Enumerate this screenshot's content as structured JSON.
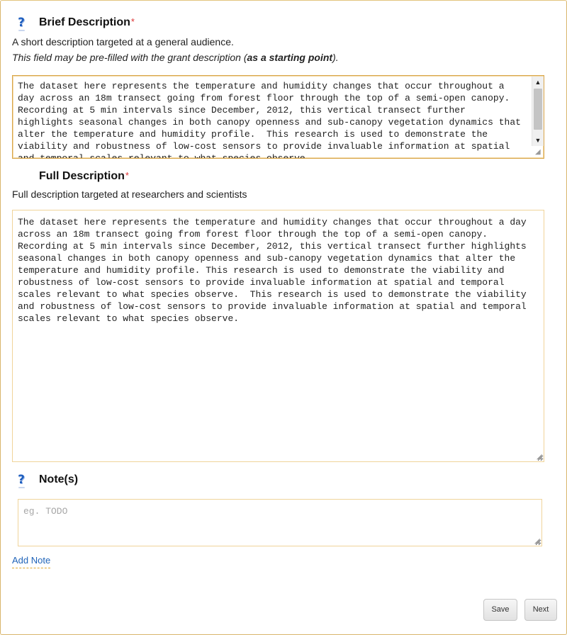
{
  "brief": {
    "title": "Brief Description",
    "required_mark": "*",
    "help_text": "A short description targeted at a general audience.",
    "note_prefix": "This field may be pre-filled with the grant description (",
    "note_bold": "as a starting point",
    "note_suffix": ").",
    "value": "The dataset here represents the temperature and humidity changes that occur throughout a day across an 18m transect going from forest floor through the top of a semi-open canopy. Recording at 5 min intervals since December, 2012, this vertical transect further highlights seasonal changes in both canopy openness and sub-canopy vegetation dynamics that alter the temperature and humidity profile.  This research is used to demonstrate the viability and robustness of low-cost sensors to provide invaluable information at spatial and temporal scales relevant to what species observe."
  },
  "full": {
    "title": "Full Description",
    "required_mark": "*",
    "help_text": "Full description targeted at researchers and scientists",
    "value": "The dataset here represents the temperature and humidity changes that occur throughout a day across an 18m transect going from forest floor through the top of a semi-open canopy. Recording at 5 min intervals since December, 2012, this vertical transect further highlights seasonal changes in both canopy openness and sub-canopy vegetation dynamics that alter the temperature and humidity profile. This research is used to demonstrate the viability and robustness of low-cost sensors to provide invaluable information at spatial and temporal scales relevant to what species observe.  This research is used to demonstrate the viability and robustness of low-cost sensors to provide invaluable information at spatial and temporal scales relevant to what species observe."
  },
  "notes": {
    "title": "Note(s)",
    "placeholder": "eg. TODO",
    "add_link": "Add Note"
  },
  "actions": {
    "save_label": "Save",
    "next_label": "Next"
  },
  "icons": {
    "help": "help-question-icon"
  },
  "colors": {
    "link": "#1f63b8",
    "required": "#dd3333",
    "focus_border": "#d9a64a"
  }
}
